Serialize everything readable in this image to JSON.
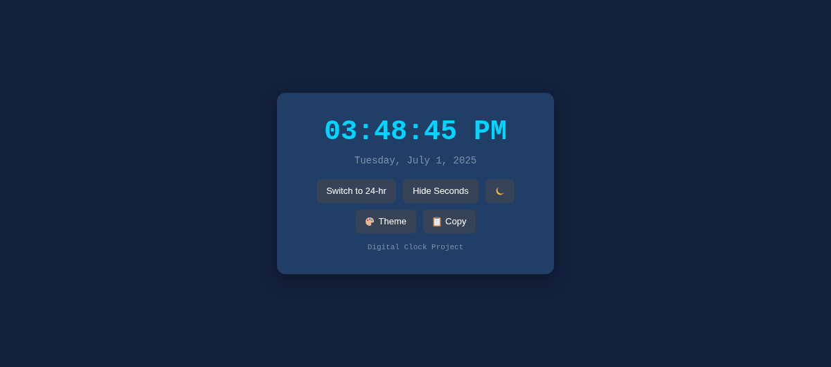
{
  "clock": {
    "time": "03:48:45 PM",
    "date": "Tuesday, July 1, 2025"
  },
  "button_rows": [
    [
      {
        "kind": "text",
        "label": "Switch to 24-hr"
      },
      {
        "kind": "text",
        "label": "Hide Seconds"
      },
      {
        "kind": "moon"
      }
    ],
    [
      {
        "kind": "palette",
        "label": "Theme"
      },
      {
        "kind": "clipboard",
        "label": "Copy"
      }
    ]
  ],
  "footer": "Digital Clock Project"
}
